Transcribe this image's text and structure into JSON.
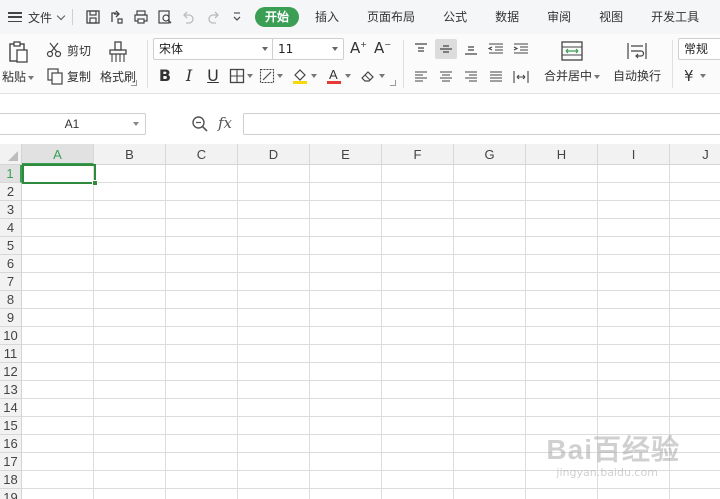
{
  "menu": {
    "file_label": "文件",
    "tabs": [
      {
        "label": "开始",
        "active": true
      },
      {
        "label": "插入"
      },
      {
        "label": "页面布局"
      },
      {
        "label": "公式"
      },
      {
        "label": "数据"
      },
      {
        "label": "审阅"
      },
      {
        "label": "视图"
      },
      {
        "label": "开发工具"
      }
    ]
  },
  "ribbon": {
    "paste": "粘贴",
    "cut": "剪切",
    "copy": "复制",
    "format_painter": "格式刷",
    "font_name": "宋体",
    "font_size": "11",
    "bold": "B",
    "italic": "I",
    "underline": "U",
    "merge_center": "合并居中",
    "wrap_text": "自动换行",
    "number_format": "常规",
    "currency": "¥"
  },
  "formula_bar": {
    "name_box": "A1",
    "fx_label": "fx",
    "formula": ""
  },
  "sheet": {
    "columns": [
      "A",
      "B",
      "C",
      "D",
      "E",
      "F",
      "G",
      "H",
      "I",
      "J"
    ],
    "rows": [
      "1",
      "2",
      "3",
      "4",
      "5",
      "6",
      "7",
      "8",
      "9",
      "10",
      "11",
      "12",
      "13",
      "14",
      "15",
      "16",
      "17",
      "18",
      "19"
    ],
    "active_cell": "A1"
  },
  "watermark": {
    "logo": "Bai百经验",
    "sub": "jingyan.baidu.com"
  },
  "colors": {
    "accent": "#3a9f54",
    "active_cell_border": "#2e8b3e",
    "font_color_bar": "#e53935",
    "fill_color_bar": "#f5d90a"
  }
}
